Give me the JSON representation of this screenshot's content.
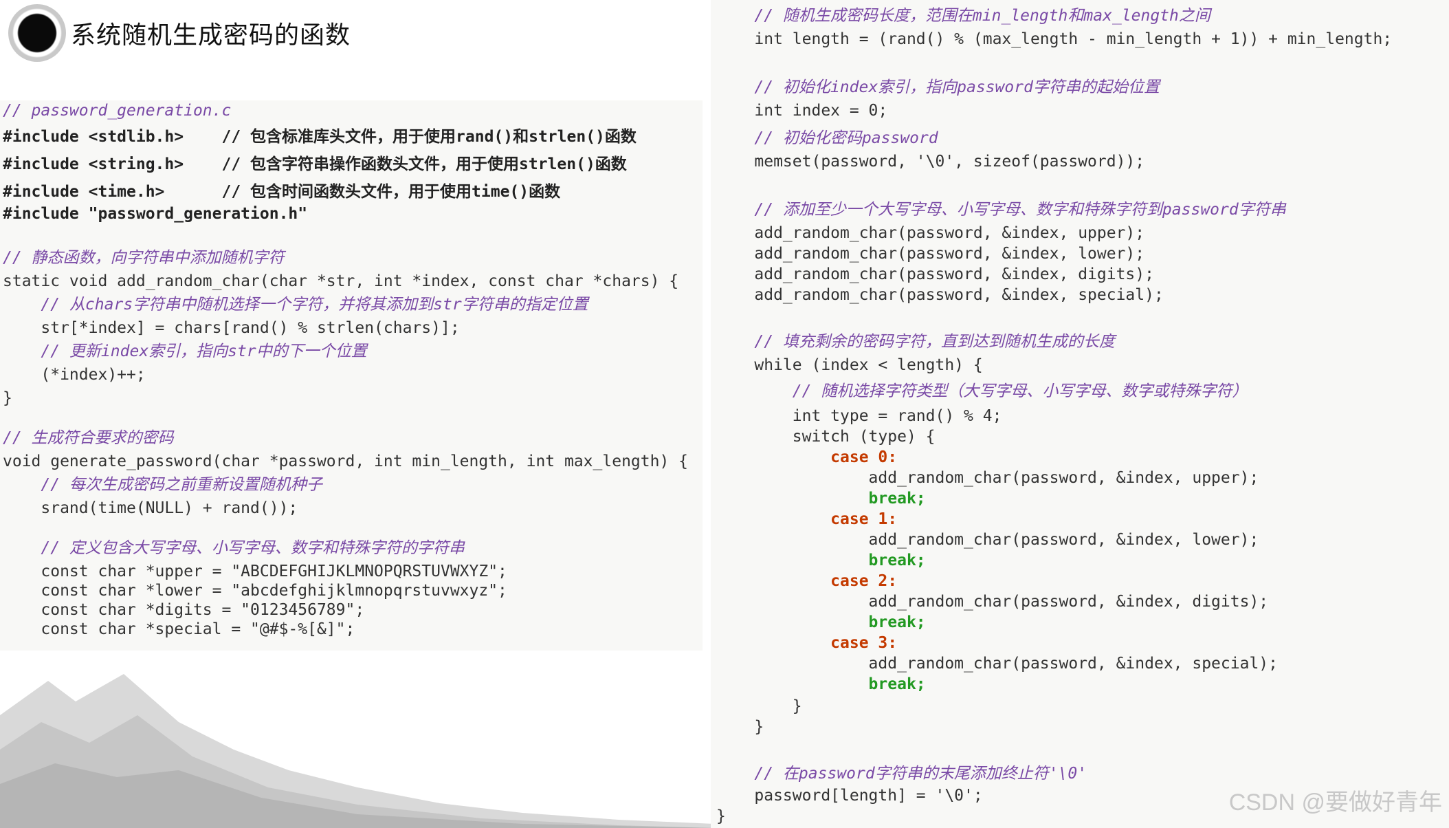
{
  "title": "系统随机生成密码的函数",
  "watermark": "CSDN @要做好青年",
  "left_lines": [
    "// password_generation.c",
    "#include <stdlib.h>    // 包含标准库头文件，用于使用rand()和strlen()函数",
    "#include <string.h>    // 包含字符串操作函数头文件，用于使用strlen()函数",
    "#include <time.h>      // 包含时间函数头文件，用于使用time()函数",
    "#include \"password_generation.h\"",
    "",
    "// 静态函数，向字符串中添加随机字符",
    "static void add_random_char(char *str, int *index, const char *chars) {",
    "    // 从chars字符串中随机选择一个字符，并将其添加到str字符串的指定位置",
    "    str[*index] = chars[rand() % strlen(chars)];",
    "    // 更新index索引，指向str中的下一个位置",
    "    (*index)++;",
    "}",
    "",
    "// 生成符合要求的密码",
    "void generate_password(char *password, int min_length, int max_length) {",
    "    // 每次生成密码之前重新设置随机种子",
    "    srand(time(NULL) + rand());",
    "",
    "    // 定义包含大写字母、小写字母、数字和特殊字符的字符串",
    "    const char *upper = \"ABCDEFGHIJKLMNOPQRSTUVWXYZ\";",
    "    const char *lower = \"abcdefghijklmnopqrstuvwxyz\";",
    "    const char *digits = \"0123456789\";",
    "    const char *special = \"@#$-%[&]\";"
  ],
  "right_lines": [
    "    // 随机生成密码长度，范围在min_length和max_length之间",
    "    int length = (rand() % (max_length - min_length + 1)) + min_length;",
    "",
    "    // 初始化index索引，指向password字符串的起始位置",
    "    int index = 0;",
    "    // 初始化密码password",
    "    memset(password, '\\0', sizeof(password));",
    "",
    "    // 添加至少一个大写字母、小写字母、数字和特殊字符到password字符串",
    "    add_random_char(password, &index, upper);",
    "    add_random_char(password, &index, lower);",
    "    add_random_char(password, &index, digits);",
    "    add_random_char(password, &index, special);",
    "",
    "    // 填充剩余的密码字符，直到达到随机生成的长度",
    "    while (index < length) {",
    "        // 随机选择字符类型（大写字母、小写字母、数字或特殊字符）",
    "        int type = rand() % 4;",
    "        switch (type) {",
    "            case 0:",
    "                add_random_char(password, &index, upper);",
    "                break;",
    "            case 1:",
    "                add_random_char(password, &index, lower);",
    "                break;",
    "            case 2:",
    "                add_random_char(password, &index, digits);",
    "                break;",
    "            case 3:",
    "                add_random_char(password, &index, special);",
    "                break;",
    "        }",
    "    }",
    "",
    "    // 在password字符串的末尾添加终止符'\\0'",
    "    password[length] = '\\0';",
    "}"
  ]
}
